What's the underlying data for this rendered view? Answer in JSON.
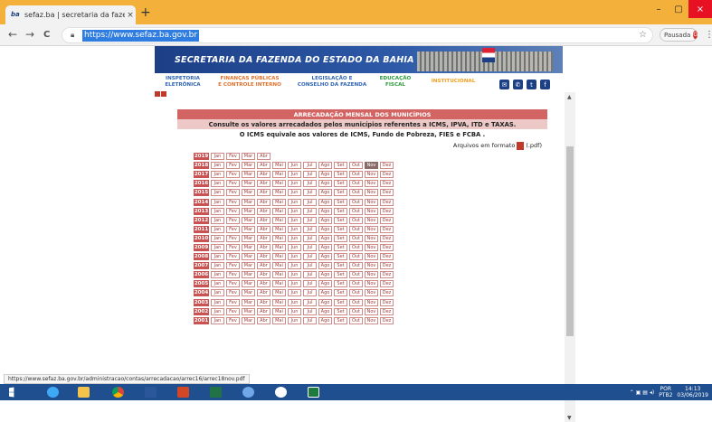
{
  "browser": {
    "tab_title": "sefaz.ba | secretaria da fazenda",
    "favicon_text": "ba",
    "tab_close": "×",
    "new_tab": "+",
    "back": "←",
    "forward": "→",
    "reload": "C",
    "url": "https://www.sefaz.ba.gov.br",
    "star": "☆",
    "profile_label": "Pausada",
    "profile_initial": "G",
    "menu": "⋮",
    "window": {
      "minimize": "–",
      "maximize": "▢",
      "close": "×"
    }
  },
  "site": {
    "banner_title": "SECRETARIA DA FAZENDA DO ESTADO DA BAHIA",
    "nav": [
      {
        "label": "INSPETORIA\nELETRÔNICA",
        "color": "#2d63b3"
      },
      {
        "label": "FINANÇAS PÚBLICAS\nE CONTROLE INTERNO",
        "color": "#e0702a"
      },
      {
        "label": "LEGISLAÇÃO E\nCONSELHO DA FAZENDA",
        "color": "#2d63b3"
      },
      {
        "label": "EDUCAÇÃO\nFISCAL",
        "color": "#2b9a3b"
      },
      {
        "label": "INSTITUCIONAL",
        "color": "#f0a020"
      }
    ],
    "social": [
      "email-icon",
      "phone-icon",
      "twitter-icon",
      "facebook-icon"
    ]
  },
  "content": {
    "heading": "ARRECADAÇÃO MENSAL DOS MUNICÍPIOS",
    "subheading": "Consulte os valores arrecadados pelos municípios referentes a ICMS, IPVA, ITD e TAXAS.",
    "note": "O ICMS equivale aos valores de ICMS, Fundo de Pobreza, FIES e FCBA .",
    "files_label": "Arquivos em formato",
    "files_ext": "(.pdf)",
    "months": [
      "Jan",
      "Fev",
      "Mar",
      "Abr",
      "Mai",
      "Jun",
      "Jul",
      "Ago",
      "Set",
      "Out",
      "Nov",
      "Dez"
    ],
    "years": [
      {
        "year": "2019",
        "count": 4
      },
      {
        "year": "2018",
        "count": 12,
        "selected": "Nov"
      },
      {
        "year": "2017",
        "count": 12
      },
      {
        "year": "2016",
        "count": 12
      },
      {
        "year": "2015",
        "count": 12
      },
      {
        "year": "2014",
        "count": 12
      },
      {
        "year": "2013",
        "count": 12
      },
      {
        "year": "2012",
        "count": 12
      },
      {
        "year": "2011",
        "count": 12
      },
      {
        "year": "2010",
        "count": 12
      },
      {
        "year": "2009",
        "count": 12
      },
      {
        "year": "2008",
        "count": 12
      },
      {
        "year": "2007",
        "count": 12
      },
      {
        "year": "2006",
        "count": 12
      },
      {
        "year": "2005",
        "count": 12
      },
      {
        "year": "2004",
        "count": 12
      },
      {
        "year": "2003",
        "count": 12
      },
      {
        "year": "2002",
        "count": 12
      },
      {
        "year": "2001",
        "count": 12
      }
    ]
  },
  "status_url": "https://www.sefaz.ba.gov.br/administracao/contas/arrecadacao/arrec16/arrec18nov.pdf",
  "taskbar": {
    "lang": "POR",
    "lang2": "PTB2",
    "time": "14:13",
    "date": "03/06/2019"
  }
}
